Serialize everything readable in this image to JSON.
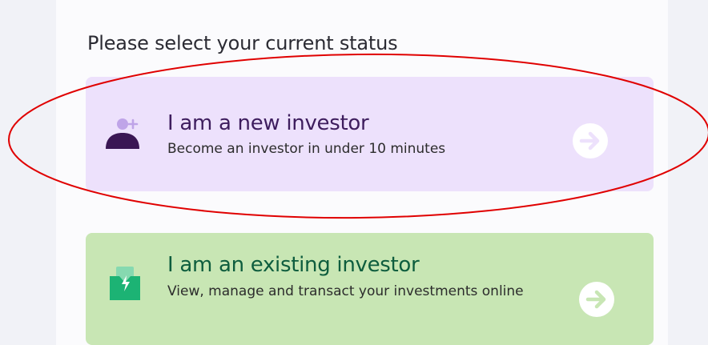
{
  "heading": "Please select your current status",
  "options": [
    {
      "title": "I am a new investor",
      "subtitle": "Become an investor in under 10 minutes",
      "icon": "add-user-icon",
      "action_icon": "arrow-right-circle-icon",
      "background": "#ede1fc",
      "title_color": "#3e1d5e",
      "icon_color": "#3a1654"
    },
    {
      "title": "I am an existing investor",
      "subtitle": "View, manage and transact your investments online",
      "icon": "wallet-icon",
      "action_icon": "arrow-right-circle-icon",
      "background": "#c8e6b4",
      "title_color": "#0e5d3e",
      "icon_color": "#1cb374"
    }
  ],
  "annotation_color": "#e00000"
}
